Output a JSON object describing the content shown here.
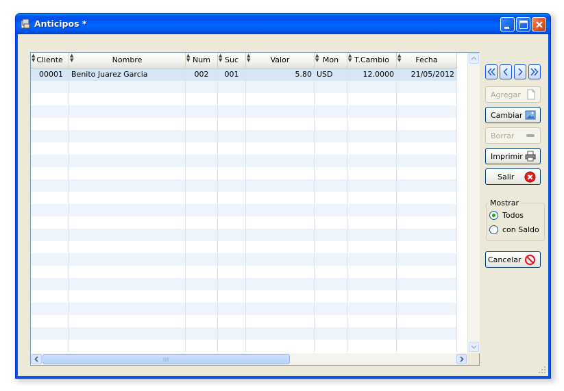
{
  "window": {
    "title": "Anticipos *",
    "controls": [
      "minimize",
      "maximize",
      "close"
    ]
  },
  "grid": {
    "columns": [
      "Cliente",
      "Nombre",
      "Num",
      "Suc",
      "Valor",
      "Mon",
      "T.Cambio",
      "Fecha"
    ],
    "rows": [
      [
        "00001",
        "Benito Juarez Garcia",
        "002",
        "001",
        "5.80",
        "USD",
        "12.0000",
        "21/05/2012"
      ]
    ],
    "selected_row": 0
  },
  "nav_buttons": [
    "first",
    "previous",
    "next",
    "last"
  ],
  "buttons": {
    "agregar": "Agregar",
    "cambiar": "Cambiar",
    "borrar": "Borrar",
    "imprimir": "Imprimir",
    "salir": "Salir",
    "cancelar": "Cancelar"
  },
  "mostrar": {
    "title": "Mostrar",
    "options": [
      "Todos",
      "con Saldo"
    ],
    "selected": "Todos"
  },
  "colors": {
    "titlebar": "#0055ea",
    "window_bg": "#ece9d8",
    "row_alt": "#eef4fc",
    "row_selected": "#d7e6f5"
  }
}
